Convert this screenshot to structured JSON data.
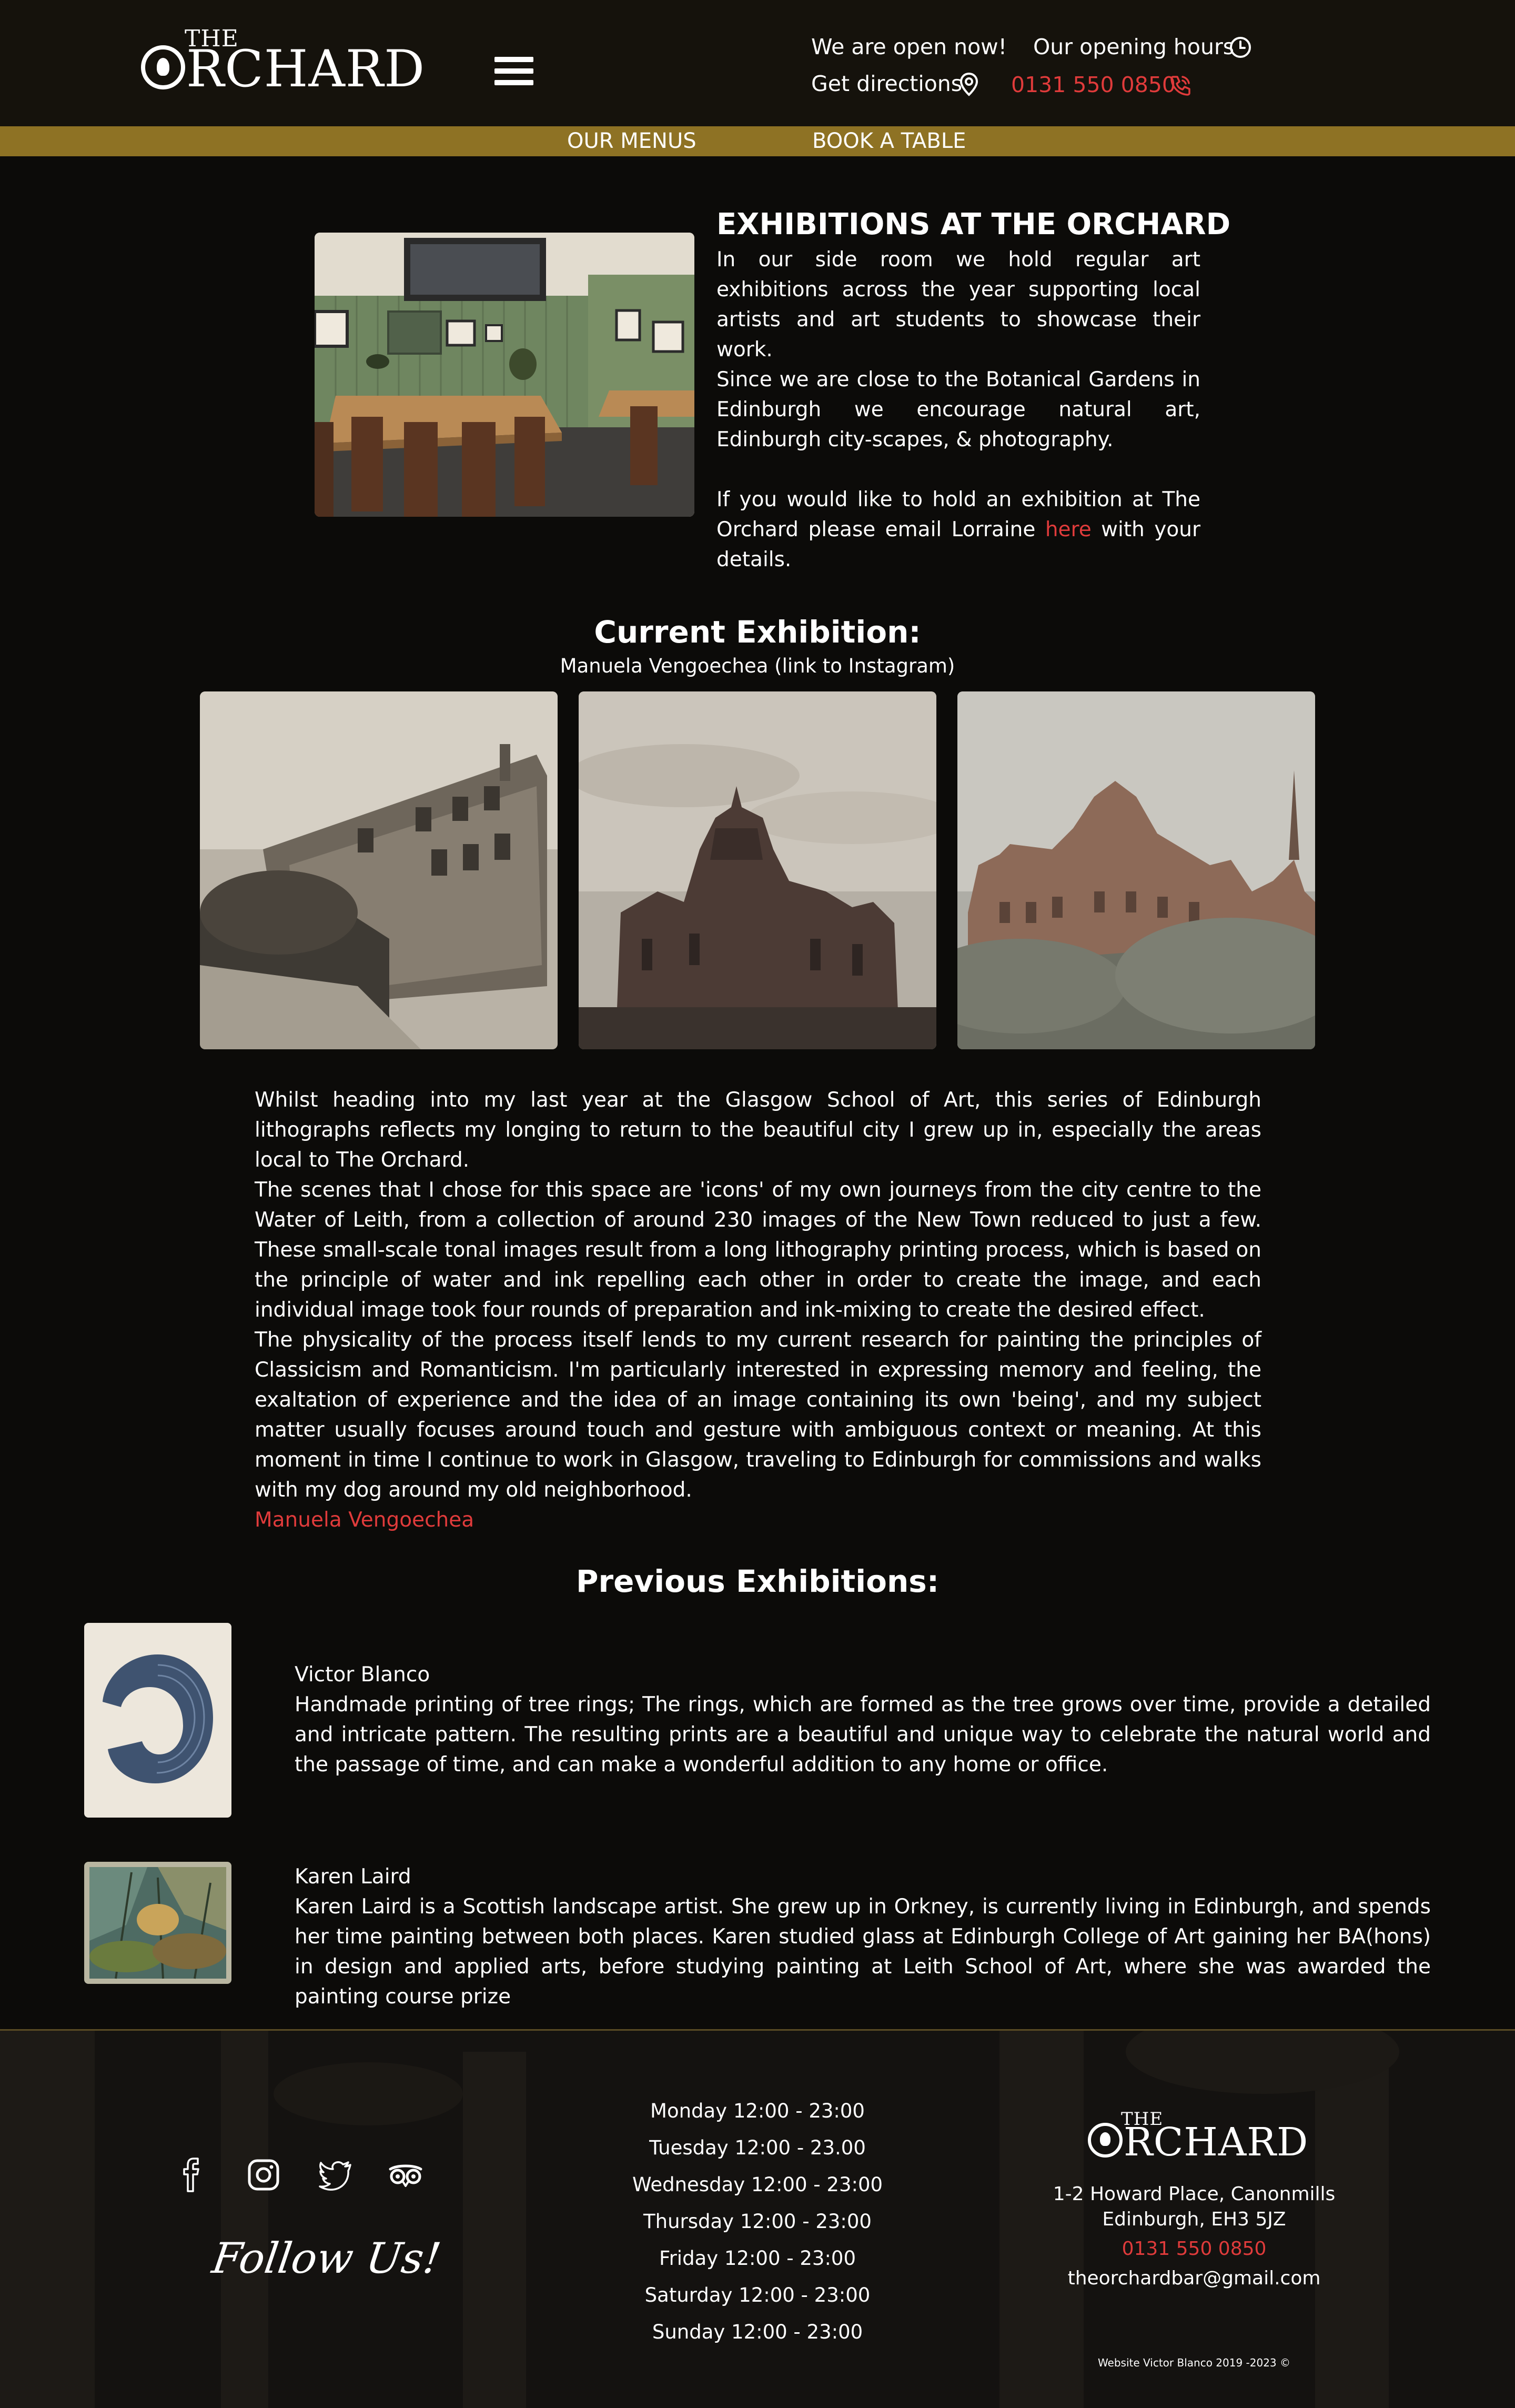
{
  "header": {
    "logo_the": "THE",
    "logo_rchard": "RCHARD",
    "open_now": "We are open now!",
    "opening_hours": "Our opening hours",
    "directions": "Get directions",
    "phone": "0131 550 0850"
  },
  "nav": {
    "menus": "OUR MENUS",
    "book": "BOOK A TABLE"
  },
  "intro": {
    "title": "EXHIBITIONS AT THE ORCHARD",
    "p1": "In our side room we hold regular art exhibitions across the year supporting local artists and art students to showcase their work.",
    "p2": "Since we are close to the Botanical Gardens in Edinburgh we encourage natural art, Edinburgh city-scapes, & photography.",
    "p3_before": "If you would like to hold an exhibition at The Orchard please email Lorraine ",
    "p3_link": "here",
    "p3_after": " with your details."
  },
  "current": {
    "title": "Current Exhibition:",
    "artist_link": "Manuela Vengoechea (link to Instagram)",
    "p1": "Whilst heading into my last year at the Glasgow School of Art, this series of Edinburgh lithographs reflects my longing to return to the beautiful city I grew up in, especially the areas local to The Orchard.",
    "p2": "The scenes that I chose for this space are 'icons' of my own journeys from the city centre to the Water of Leith, from a collection of around 230 images of the New Town reduced to just a few. These small-scale tonal images result from a long lithography printing process, which is based on the principle of water and ink repelling each other in order to create the image, and each individual image took four rounds of preparation and ink-mixing to create the desired effect.",
    "p3": "The physicality of the process itself lends to my current research for painting the principles of Classicism and Romanticism. I'm particularly interested in expressing memory and feeling, the exaltation of experience and the idea of an image containing its own 'being', and my subject matter usually focuses around touch and gesture with ambiguous context or meaning. At this moment in time I continue to work in Glasgow, traveling to Edinburgh for commissions and walks with my dog around my old neighborhood.",
    "signature": "Manuela Vengoechea"
  },
  "previous": {
    "title": "Previous Exhibitions:",
    "items": [
      {
        "name": "Victor Blanco",
        "desc": "Handmade printing of tree rings; The rings, which are formed as the tree grows over time, provide a detailed and intricate pattern. The resulting prints are a beautiful and unique way to celebrate the natural world and the passage of time, and can make a wonderful addition to any home or office."
      },
      {
        "name": "Karen Laird",
        "desc": "Karen Laird is a Scottish landscape artist. She grew up in Orkney, is currently living in Edinburgh, and spends her time painting between both places. Karen studied glass at Edinburgh College of Art gaining her BA(hons) in design and applied arts, before studying painting at Leith School of Art, where she was awarded the painting course prize"
      }
    ]
  },
  "footer": {
    "follow": "Follow Us!",
    "hours": [
      "Monday 12:00 - 23:00",
      "Tuesday 12:00 - 23.00",
      "Wednesday 12:00 - 23:00",
      "Thursday 12:00 - 23:00",
      "Friday 12:00 - 23:00",
      "Saturday 12:00 - 23:00",
      "Sunday 12:00 - 23:00"
    ],
    "address1": "1-2 Howard Place, Canonmills",
    "address2": "Edinburgh, EH3 5JZ",
    "phone": "0131 550 0850",
    "email": "theorchardbar@gmail.com",
    "credit": "Website Victor Blanco 2019 -2023 ©",
    "social_icons": [
      "facebook-icon",
      "instagram-icon",
      "twitter-icon",
      "tripadvisor-icon"
    ]
  },
  "colors": {
    "accent_gold": "#8e7224",
    "link_red": "#e03b3b",
    "header_bg": "#15120c",
    "page_bg": "#0c0b09"
  }
}
